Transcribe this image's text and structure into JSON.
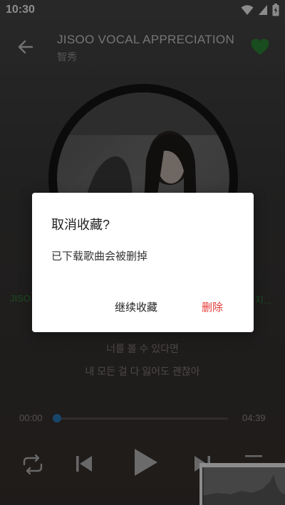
{
  "status_bar": {
    "time": "10:30"
  },
  "header": {
    "title": "JISOO VOCAL APPRECIATION",
    "subtitle": "智秀",
    "favorite_color": "#2e8b3a"
  },
  "lyrics": {
    "left_fragment": "JISO",
    "right_fragment": "지...",
    "lines": [
      "너를 볼 수 있다면",
      "내 모든 걸 다 잃어도 괜찮아"
    ],
    "highlight_color": "#2f8a3b"
  },
  "player": {
    "current_time": "00:00",
    "total_time": "04:39",
    "progress": 0,
    "accent_color": "#2d7fc1"
  },
  "dialog": {
    "title": "取消收藏?",
    "message": "已下载歌曲会被删掉",
    "keep_label": "继续收藏",
    "delete_label": "删除",
    "delete_color": "#e53935"
  },
  "icons": [
    "wifi-icon",
    "signal-icon",
    "battery-icon",
    "back-arrow-icon",
    "heart-icon",
    "repeat-icon",
    "previous-icon",
    "play-icon",
    "next-icon",
    "playlist-icon"
  ]
}
